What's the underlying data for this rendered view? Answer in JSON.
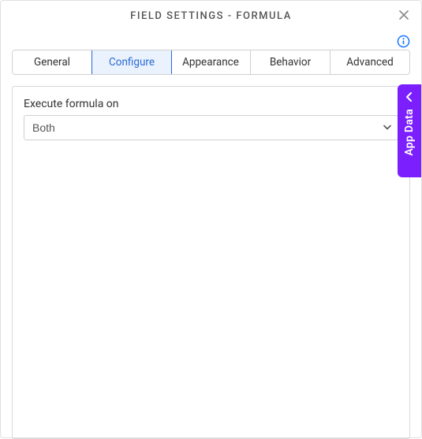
{
  "header": {
    "title": "FIELD SETTINGS - FORMULA"
  },
  "tabs": {
    "general": "General",
    "configure": "Configure",
    "appearance": "Appearance",
    "behavior": "Behavior",
    "advanced": "Advanced"
  },
  "form": {
    "executeLabel": "Execute formula on",
    "executeValue": "Both"
  },
  "sideTab": {
    "label": "App Data"
  }
}
